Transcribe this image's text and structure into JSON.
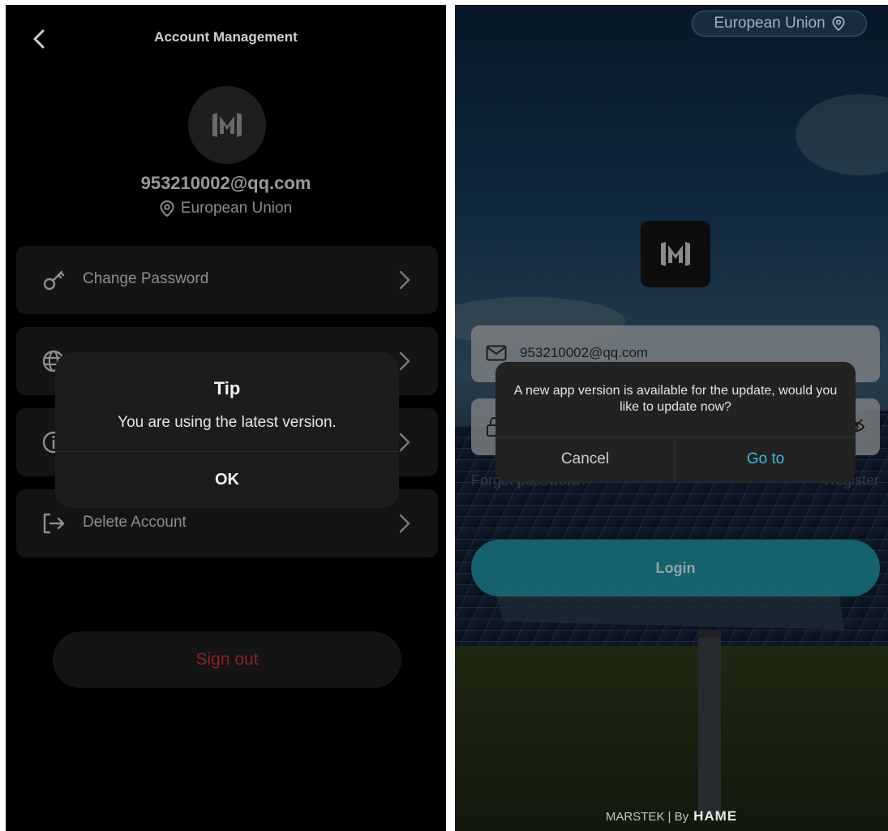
{
  "left": {
    "header": {
      "title": "Account Management",
      "back_icon": "chevron-left-icon"
    },
    "profile": {
      "email": "953210002@qq.com",
      "region": "European Union"
    },
    "menu": [
      {
        "label": "Change Password",
        "icon": "key-icon"
      },
      {
        "label": "",
        "icon": "globe-icon"
      },
      {
        "label": "",
        "icon": "info-icon"
      },
      {
        "label": "Delete Account",
        "icon": "logout-icon"
      }
    ],
    "sign_out_label": "Sign out",
    "dialog": {
      "title": "Tip",
      "message": "You are using the latest version.",
      "ok_label": "OK"
    }
  },
  "right": {
    "region": "European Union",
    "login_form": {
      "email_value": "953210002@qq.com",
      "forgot_label": "Forgot password?",
      "register_label": "Register",
      "login_label": "Login"
    },
    "dialog": {
      "message": "A new app version is available for the update, would you like to update now?",
      "cancel_label": "Cancel",
      "goto_label": "Go to"
    },
    "footer": {
      "text": "MARSTEK | By",
      "brand": "HAME"
    }
  },
  "colors": {
    "accent": "#3fb9d9",
    "danger": "#8a2323",
    "login_button": "#166976"
  }
}
